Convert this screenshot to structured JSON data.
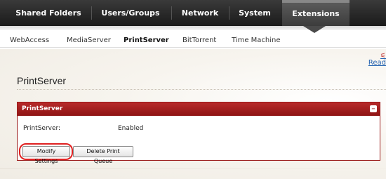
{
  "top_nav": {
    "items": [
      {
        "label": "Shared Folders",
        "active": false
      },
      {
        "label": "Users/Groups",
        "active": false
      },
      {
        "label": "Network",
        "active": false
      },
      {
        "label": "System",
        "active": false
      },
      {
        "label": "Extensions",
        "active": true
      }
    ]
  },
  "sub_nav": {
    "tabs": [
      {
        "label": "WebAccess",
        "active": false
      },
      {
        "label": "MediaServer",
        "active": false
      },
      {
        "label": "PrintServer",
        "active": true
      },
      {
        "label": "BitTorrent",
        "active": false
      },
      {
        "label": "Time Machine",
        "active": false
      }
    ]
  },
  "help_link": {
    "label": "Read"
  },
  "page": {
    "title": "PrintServer"
  },
  "panel": {
    "header": "PrintServer",
    "collapse_icon": "minus-icon",
    "rows": [
      {
        "label": "PrintServer:",
        "value": "Enabled"
      }
    ],
    "buttons": {
      "modify": "Modify Settings",
      "delete_queue": "Delete Print Queue"
    }
  },
  "colors": {
    "nav_bg": "#1a1a1a",
    "panel_header": "#a01e1e",
    "highlight_ring": "#e02020",
    "link": "#2060b0"
  }
}
